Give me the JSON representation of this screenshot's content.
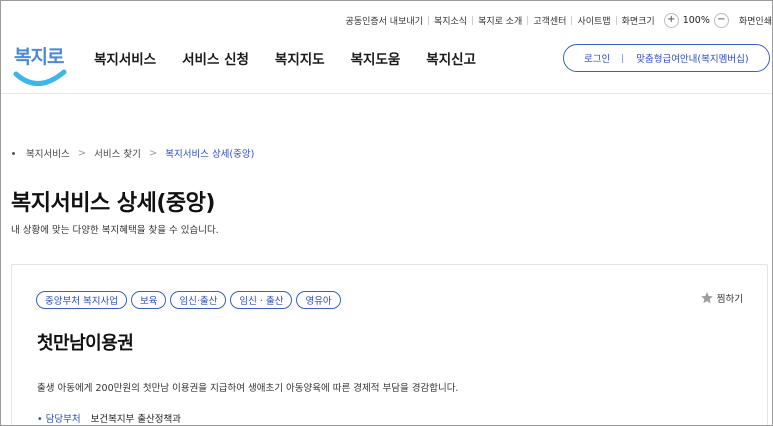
{
  "utility": {
    "links": [
      "공동인증서 내보내기",
      "복지소식",
      "복지로 소개",
      "고객센터",
      "사이트맵"
    ],
    "zoom_label": "화면크기",
    "zoom_in": "+",
    "zoom_value": "100%",
    "zoom_out": "−",
    "print_label": "화면인쇄"
  },
  "logo": {
    "text": "복지로"
  },
  "nav": {
    "items": [
      "복지서비스",
      "서비스 신청",
      "복지지도",
      "복지도움",
      "복지신고"
    ]
  },
  "auth": {
    "login": "로그인",
    "membership": "맞춤형급여안내(복지멤버십)"
  },
  "breadcrumb": {
    "items": [
      "복지서비스",
      "서비스 찾기"
    ],
    "current": "복지서비스 상세(중앙)"
  },
  "page": {
    "title": "복지서비스 상세(중앙)",
    "description": "내 상황에 맞는 다양한 복지혜택을 찾을 수 있습니다."
  },
  "service": {
    "tags": [
      "중앙부처 복지사업",
      "보육",
      "임신·출산",
      "임신 · 출산",
      "영유아"
    ],
    "bookmark_label": "찜하기",
    "title": "첫만남이용권",
    "description": "출생 아동에게 200만원의 첫만남 이용권을 지급하여 생애초기 아동양육에 따른 경제적 부담을 경감합니다.",
    "dept_label": "• 담당부처",
    "dept_value": "보건복지부 출산정책과"
  },
  "colors": {
    "brand_blue": "#2e4dbf",
    "logo_blue": "#4a8ad8",
    "logo_smile": "#3fb6e8"
  }
}
